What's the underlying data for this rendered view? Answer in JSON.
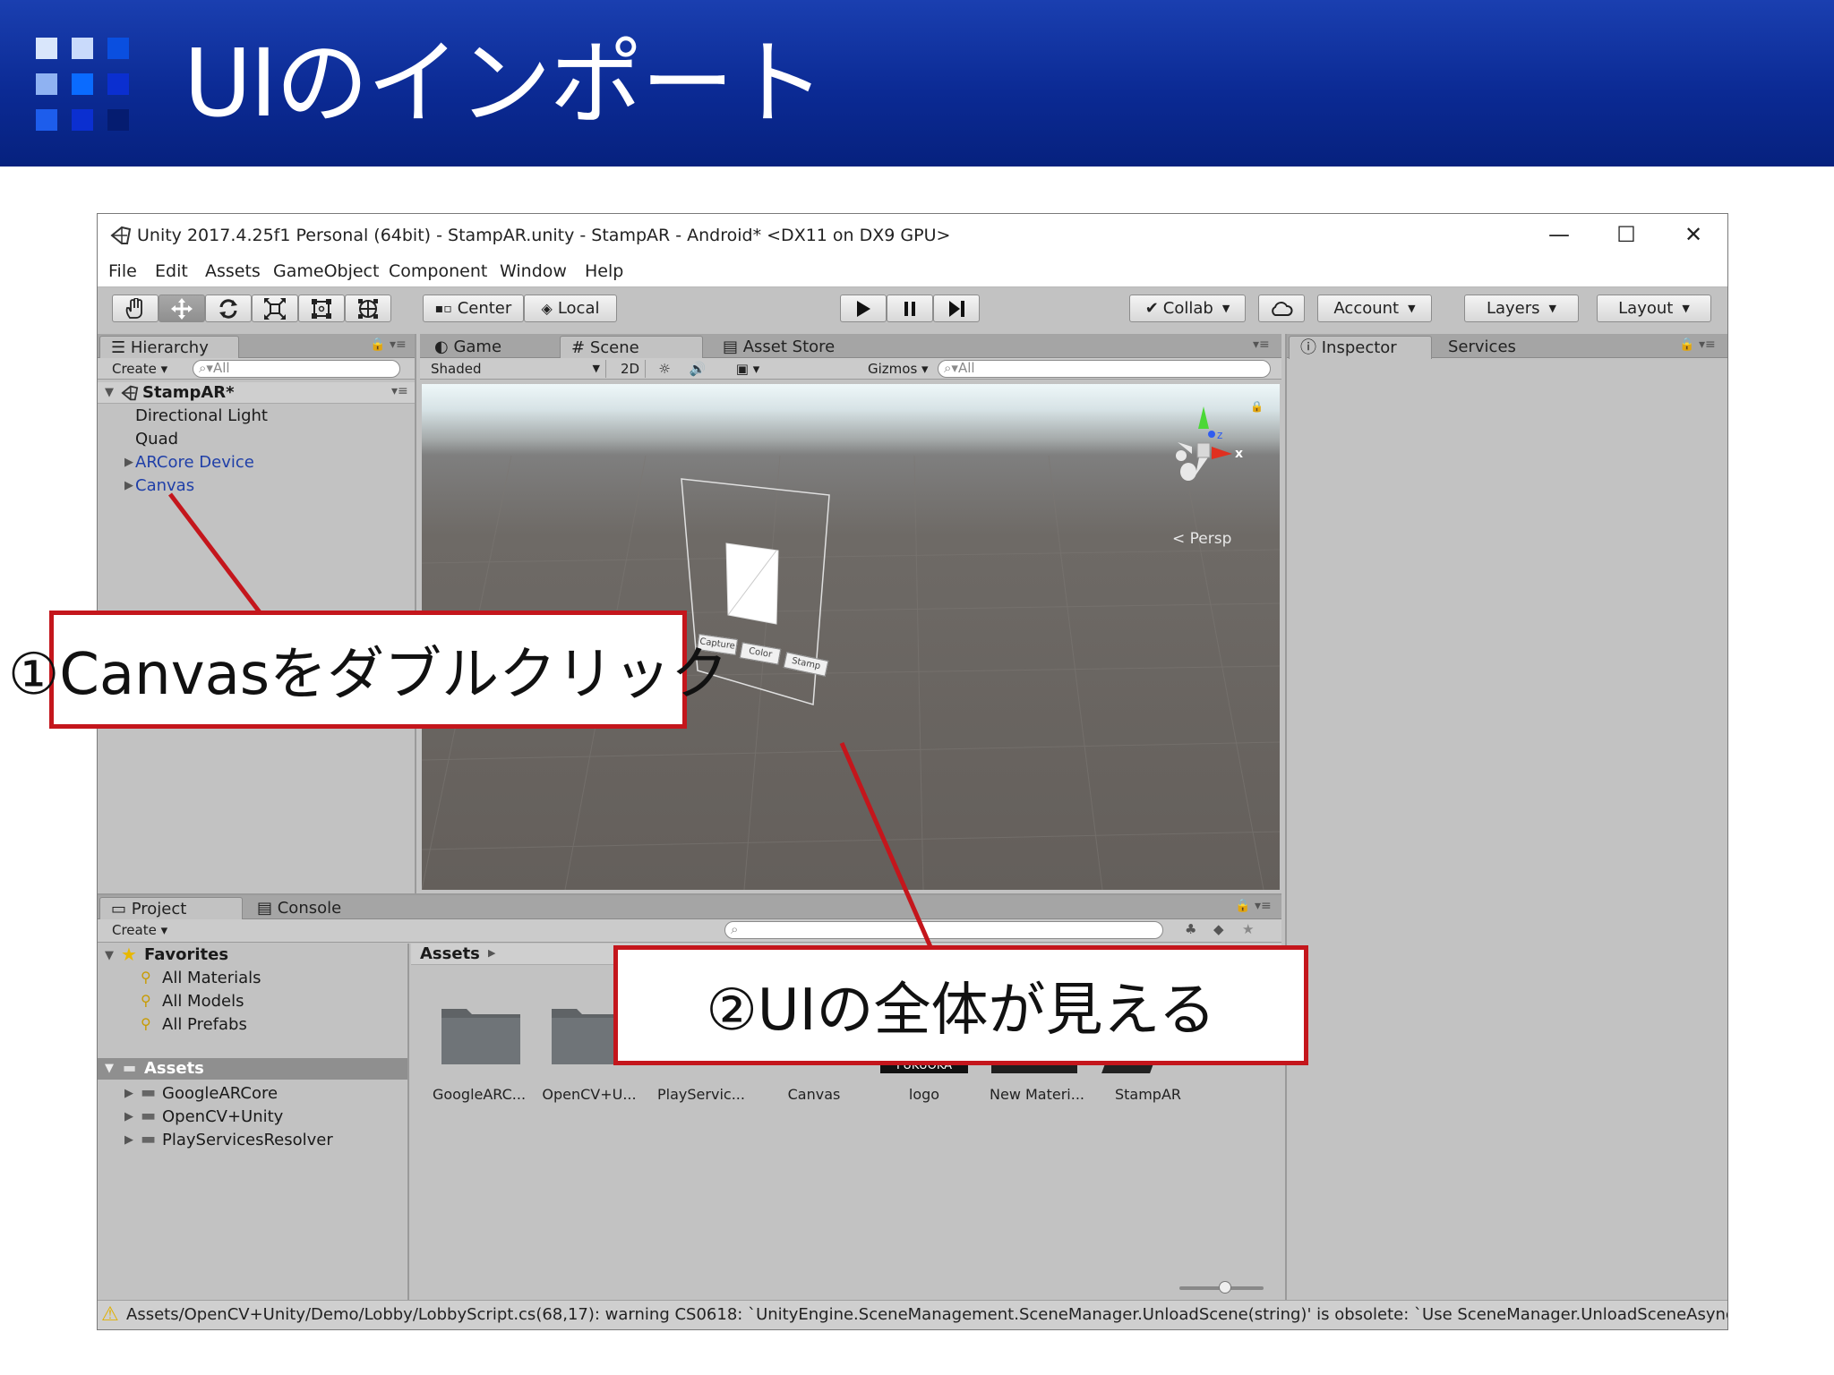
{
  "slide": {
    "title": "UIのインポート",
    "logo_colors": [
      "#d9e6fb",
      "#ffffff",
      "#0a4fe0",
      "#8fb2f2",
      "#0a6bff",
      "#0b2fd0",
      "#1d5dec",
      "#0b2fd0",
      "#06217e"
    ]
  },
  "window": {
    "title": "Unity 2017.4.25f1 Personal (64bit) - StampAR.unity - StampAR - Android* <DX11 on DX9 GPU>",
    "controls": {
      "minimize": "—",
      "maximize": "☐",
      "close": "✕"
    },
    "menu": [
      "File",
      "Edit",
      "Assets",
      "GameObject",
      "Component",
      "Window",
      "Help"
    ]
  },
  "toolbar": {
    "tools": [
      "hand-icon",
      "move-icon",
      "rotate-icon",
      "scale-icon",
      "rect-icon",
      "transform-icon"
    ],
    "pivot": "Center",
    "space": "Local",
    "collab": "Collab",
    "account": "Account",
    "layers": "Layers",
    "layout": "Layout"
  },
  "hierarchy": {
    "tab": "Hierarchy",
    "create": "Create",
    "search_placeholder": "All",
    "scene": "StampAR*",
    "items": [
      "Directional Light",
      "Quad",
      "ARCore Device",
      "Canvas"
    ]
  },
  "scene_view": {
    "tabs": [
      "Game",
      "Scene",
      "Asset Store"
    ],
    "shading": "Shaded",
    "mode_2d": "2D",
    "gizmos": "Gizmos",
    "search_placeholder": "All",
    "persp": "Persp",
    "axis_z": "z",
    "axis_x": "x",
    "ui_buttons": [
      "Capture",
      "Color",
      "Stamp"
    ]
  },
  "inspector": {
    "tabs": [
      "Inspector",
      "Services"
    ]
  },
  "project": {
    "tabs": [
      "Project",
      "Console"
    ],
    "create": "Create",
    "favorites": {
      "label": "Favorites",
      "items": [
        "All Materials",
        "All Models",
        "All Prefabs"
      ]
    },
    "assets_root": {
      "label": "Assets",
      "items": [
        "GoogleARCore",
        "OpenCV+Unity",
        "PlayServicesResolver"
      ]
    },
    "breadcrumb": "Assets",
    "assets": [
      "GoogleARC...",
      "OpenCV+U...",
      "PlayServic...",
      "Canvas",
      "logo",
      "New Materi...",
      "StampAR"
    ],
    "logo_thumb_text": "FUKUOKA"
  },
  "status_bar": {
    "message": "Assets/OpenCV+Unity/Demo/Lobby/LobbyScript.cs(68,17): warning CS0618: `UnityEngine.SceneManagement.SceneManager.UnloadScene(string)' is obsolete: `Use SceneManager.UnloadSceneAsync. This function is not safe to use during triggers and under other circumstances. See Scripting reference for more details.'"
  },
  "callouts": {
    "first": "①Canvasをダブルクリック",
    "second": "②UIの全体が見える"
  },
  "colors": {
    "header_blue": "#0b2a94",
    "callout_red": "#c4161c",
    "unity_gray": "#c2c2c2",
    "link_blue": "#1f3fa8"
  }
}
